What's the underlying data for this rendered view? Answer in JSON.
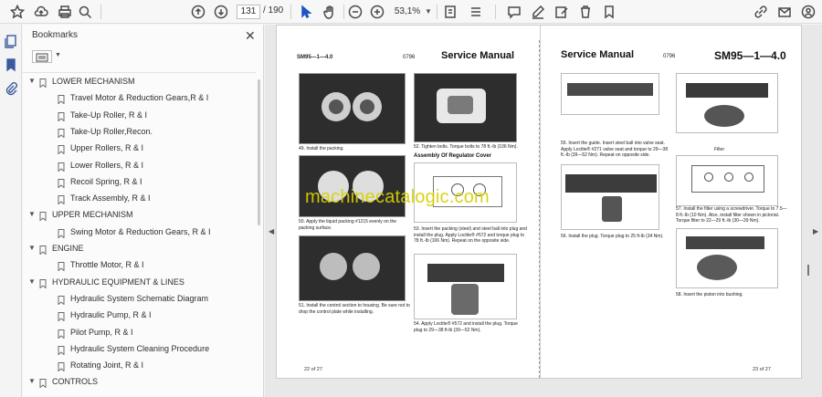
{
  "toolbar": {
    "current_page": "131",
    "total_pages": "/ 190",
    "zoom": "53,1%",
    "icons": [
      "star-icon",
      "cloud-upload-icon",
      "print-icon",
      "zoom-search-icon",
      "page-up-icon",
      "page-down-icon",
      "pointer-icon",
      "hand-icon",
      "zoom-out-icon",
      "zoom-in-icon",
      "fit-page-icon",
      "scroll-mode-icon",
      "comment-icon",
      "highlight-pen-icon",
      "edit-icon",
      "delete-icon",
      "stamp-icon",
      "link-icon",
      "mail-icon",
      "account-icon"
    ]
  },
  "panel": {
    "title": "Bookmarks",
    "items": [
      {
        "label": "LOWER MECHANISM",
        "level": 0
      },
      {
        "label": "Travel Motor & Reduction  Gears,R & I",
        "level": 1
      },
      {
        "label": "Take-Up Roller, R & I",
        "level": 1
      },
      {
        "label": "Take-Up Roller,Recon.",
        "level": 1
      },
      {
        "label": "Upper Rollers, R & I",
        "level": 1
      },
      {
        "label": "Lower Rollers, R & I",
        "level": 1
      },
      {
        "label": "Recoil Spring, R & I",
        "level": 1
      },
      {
        "label": "Track Assembly, R & I",
        "level": 1
      },
      {
        "label": "UPPER MECHANISM",
        "level": 0
      },
      {
        "label": "Swing Motor & Reduction Gears, R & I",
        "level": 1
      },
      {
        "label": "ENGINE",
        "level": 0
      },
      {
        "label": "Throttle Motor, R & I",
        "level": 1
      },
      {
        "label": "HYDRAULIC EQUIPMENT & LINES",
        "level": 0
      },
      {
        "label": "Hydraulic System Schematic Diagram",
        "level": 1
      },
      {
        "label": "Hydraulic Pump, R & I",
        "level": 1
      },
      {
        "label": "Pilot Pump, R & I",
        "level": 1
      },
      {
        "label": "Hydraulic System Cleaning Procedure",
        "level": 1
      },
      {
        "label": "Rotating Joint, R & I",
        "level": 1
      },
      {
        "label": "CONTROLS",
        "level": 0
      }
    ]
  },
  "document": {
    "watermark": "machinecatalogic.com",
    "left_page": {
      "code": "SM95—1—4.0",
      "num": "0796",
      "title": "Service Manual",
      "captions": {
        "c49": "49. Install the packing.",
        "c52": "52. Tighten bolts. Torque bolts to 78 ft.-lb (106 Nm).",
        "heading": "Assembly Of Regulator Cover",
        "c50": "50. Apply the liquid packing #1215 evenly on the packing surface.",
        "c53": "53. Insert the packing (steel) and steel ball into plug and install the plug. Apply Loctite® #572 and torque plug to 78 ft.-lb (106 Nm). Repeat on the opposite side.",
        "c51": "51. Install the control section to housing. Be sure not to drop the control plate while installing.",
        "c54": "54. Apply Loctite® #572 and install the plug. Torque plug to 29—38 ft-lb (39—52 Nm)."
      },
      "footer": "22 of 27"
    },
    "right_page": {
      "title": "Service Manual",
      "num": "0796",
      "code": "SM95—1—4.0",
      "captions": {
        "c55": "55. Insert the guide. Insert steel ball into valve seat. Apply Loctite® #271 valve seat and torque to 29—38 ft.-lb (39—52 Nm). Repeat on opposite side.",
        "filter": "Filter",
        "c56": "56. Install the plug. Torque plug to 25 ft-lb (34 Nm).",
        "c57": "57. Install the filter using a screwdriver. Torque to 7.5—8 ft.-lb (10 Nm). Also, install filter shown in pictorial. Torque filter to 22—29 ft.-lb (30—39 Nm).",
        "c58": "58. Insert the piston into bushing."
      },
      "footer": "23 of 27"
    }
  }
}
